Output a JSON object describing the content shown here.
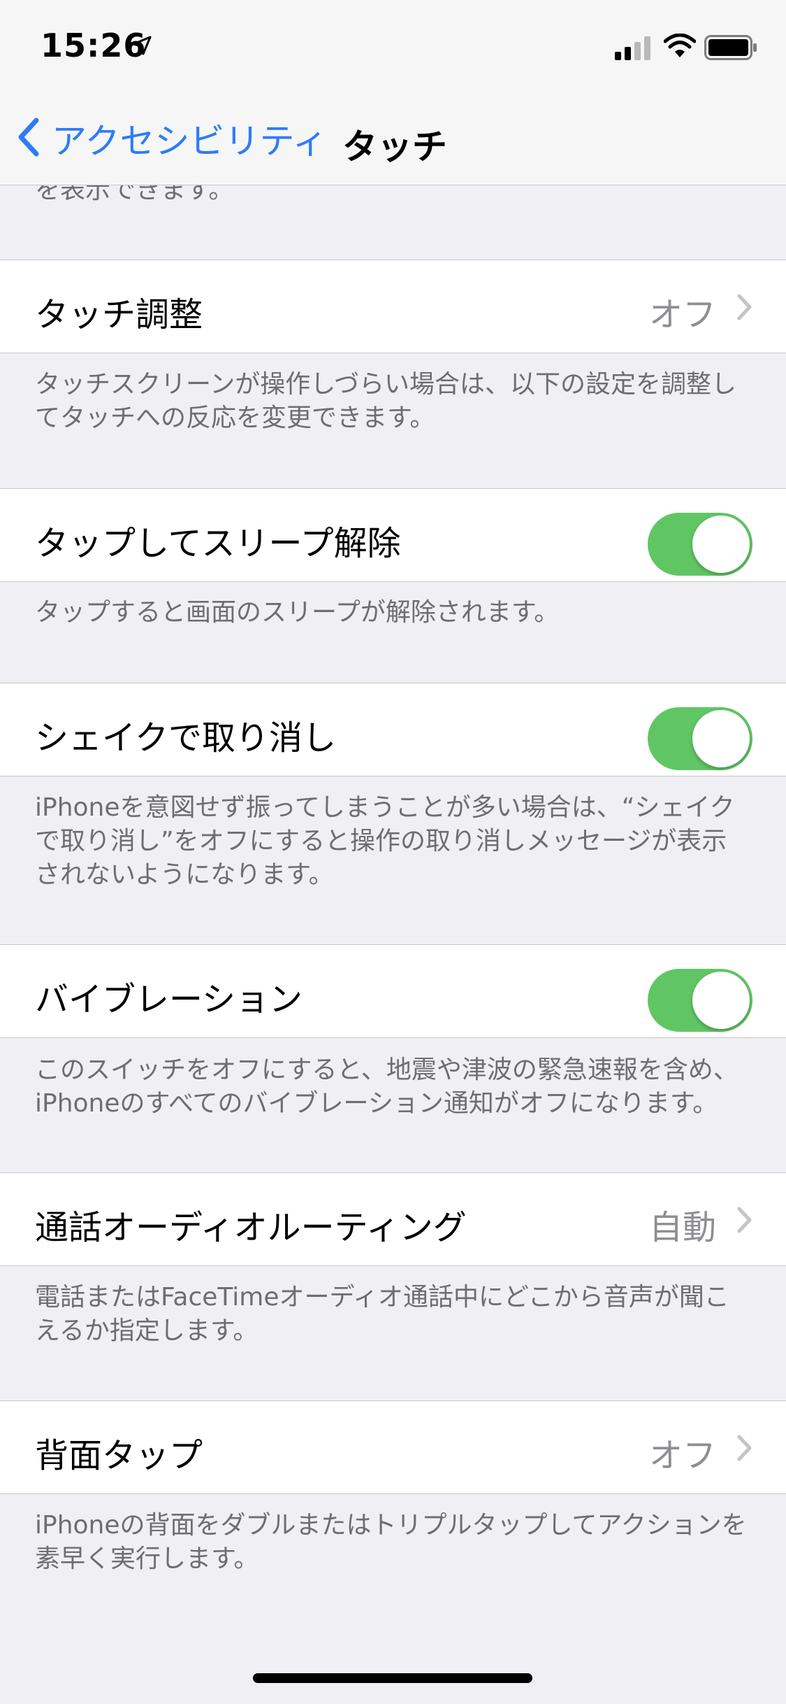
{
  "status_bar": {
    "time": "15:26",
    "location_icon": "location-arrow-icon",
    "signal_icon": "cellular-signal-icon",
    "wifi_icon": "wifi-icon",
    "battery_icon": "battery-icon"
  },
  "nav": {
    "back_label": "アクセシビリティ",
    "back_icon": "chevron-left-icon",
    "title": "タッチ"
  },
  "content": {
    "cut_text": "を表示できます。",
    "rows": [
      {
        "label": "タッチ調整",
        "value": "オフ",
        "footer": "タッチスクリーンが操作しづらい場合は、以下の設定を調整してタッチへの反応を変更できます。"
      },
      {
        "label": "タップしてスリープ解除",
        "toggle_on": true,
        "footer": "タップすると画面のスリープが解除されます。"
      },
      {
        "label": "シェイクで取り消し",
        "toggle_on": true,
        "footer": "iPhoneを意図せず振ってしまうことが多い場合は、“シェイクで取り消し”をオフにすると操作の取り消しメッセージが表示されないようになります。"
      },
      {
        "label": "バイブレーション",
        "toggle_on": true,
        "footer": "このスイッチをオフにすると、地震や津波の緊急速報を含め、iPhoneのすべてのバイブレーション通知がオフになります。"
      },
      {
        "label": "通話オーディオルーティング",
        "value": "自動",
        "footer": "電話またはFaceTimeオーディオ通話中にどこから音声が聞こえるか指定します。"
      },
      {
        "label": "背面タップ",
        "value": "オフ",
        "footer": "iPhoneの背面をダブルまたはトリプルタップしてアクションを素早く実行します。"
      }
    ]
  },
  "colors": {
    "accent": "#2d7cf6",
    "toggle_on": "#60c664",
    "background": "#efeff4",
    "secondary_text": "#6d6d72"
  }
}
